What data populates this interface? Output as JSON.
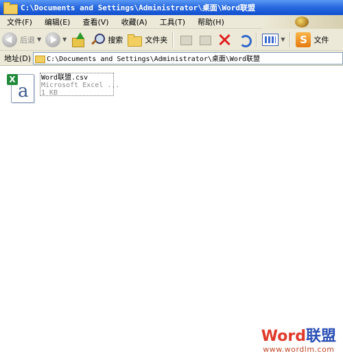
{
  "window": {
    "title": "C:\\Documents and Settings\\Administrator\\桌面\\Word联盟"
  },
  "menu": {
    "items": [
      "文件(F)",
      "编辑(E)",
      "查看(V)",
      "收藏(A)",
      "工具(T)",
      "帮助(H)"
    ]
  },
  "toolbar": {
    "back_label": "后退",
    "search_label": "搜索",
    "folders_label": "文件夹",
    "extra_label": "文件"
  },
  "address": {
    "label": "地址(D)",
    "path": "C:\\Documents and Settings\\Administrator\\桌面\\Word联盟"
  },
  "files": [
    {
      "name": "Word联盟.csv",
      "type": "Microsoft Excel ...",
      "size": "1 KB",
      "icon": "excel-csv-icon"
    }
  ],
  "watermark": {
    "logo_part1": "Word",
    "logo_part2": "联盟",
    "url": "www.wordlm.com"
  },
  "colors": {
    "titlebar": "#0f4fd0",
    "chrome": "#ece9d8",
    "excel_green": "#1f8a3a"
  }
}
